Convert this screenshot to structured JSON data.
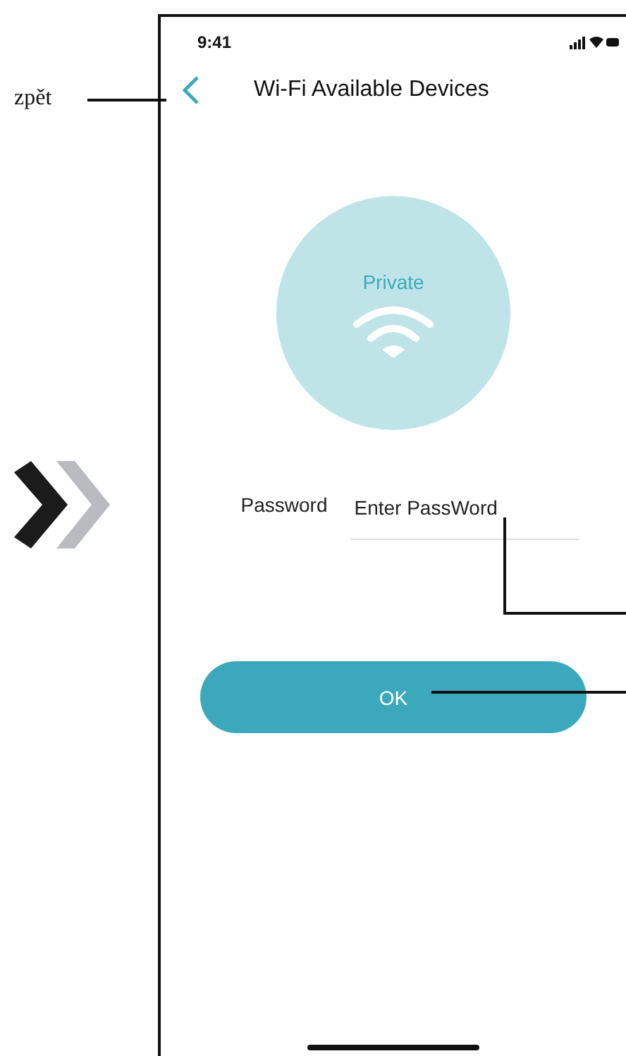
{
  "annotation": {
    "label": "zpět"
  },
  "status_bar": {
    "time": "9:41"
  },
  "header": {
    "title": "Wi-Fi Available Devices"
  },
  "network": {
    "name": "Private"
  },
  "password": {
    "label": "Password",
    "placeholder": "Enter PassWord"
  },
  "button": {
    "label": "OK"
  }
}
